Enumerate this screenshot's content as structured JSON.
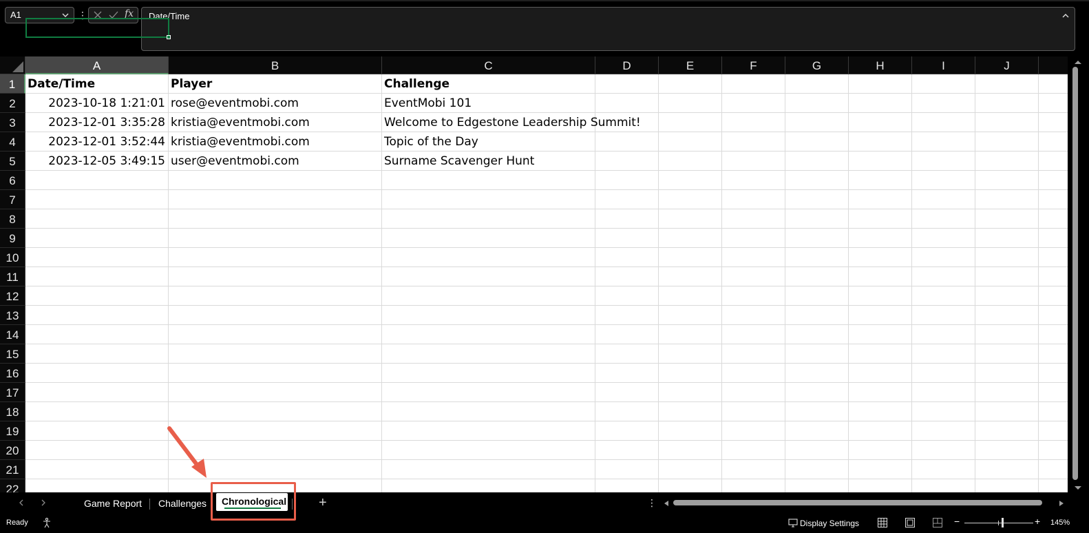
{
  "formula_bar": {
    "name_box": "A1",
    "formula": "Date/Time"
  },
  "columns": [
    "A",
    "B",
    "C",
    "D",
    "E",
    "F",
    "G",
    "H",
    "I",
    "J"
  ],
  "rows": [
    "1",
    "2",
    "3",
    "4",
    "5",
    "6",
    "7",
    "8",
    "9",
    "10",
    "11",
    "12",
    "13",
    "14",
    "15",
    "16",
    "17",
    "18",
    "19",
    "20",
    "21",
    "22"
  ],
  "cells": {
    "A1": "Date/Time",
    "B1": "Player",
    "C1": "Challenge",
    "A2": "2023-10-18 1:21:01",
    "B2": "rose@eventmobi.com",
    "C2": "EventMobi 101",
    "A3": "2023-12-01 3:35:28",
    "B3": "kristia@eventmobi.com",
    "C3": "Welcome to Edgestone Leadership Summit!",
    "A4": "2023-12-01 3:52:44",
    "B4": "kristia@eventmobi.com",
    "C4": "Topic of the Day",
    "A5": "2023-12-05 3:49:15",
    "B5": "user@eventmobi.com",
    "C5": "Surname Scavenger Hunt"
  },
  "sheet_tabs": {
    "tabs": [
      "Game Report",
      "Challenges",
      "Chronological"
    ],
    "active": "Chronological"
  },
  "status_bar": {
    "ready": "Ready",
    "display_settings": "Display Settings",
    "zoom": "145%"
  },
  "colors": {
    "accent": "#107c41",
    "annotation": "#e85e4a"
  },
  "icons": {
    "namebox": "chevron-down-icon",
    "cancel": "close-icon",
    "enter": "check-icon",
    "function": "fx-icon",
    "expand": "chevron-up-icon",
    "add_sheet": "plus-icon",
    "accessibility": "accessibility-icon"
  }
}
